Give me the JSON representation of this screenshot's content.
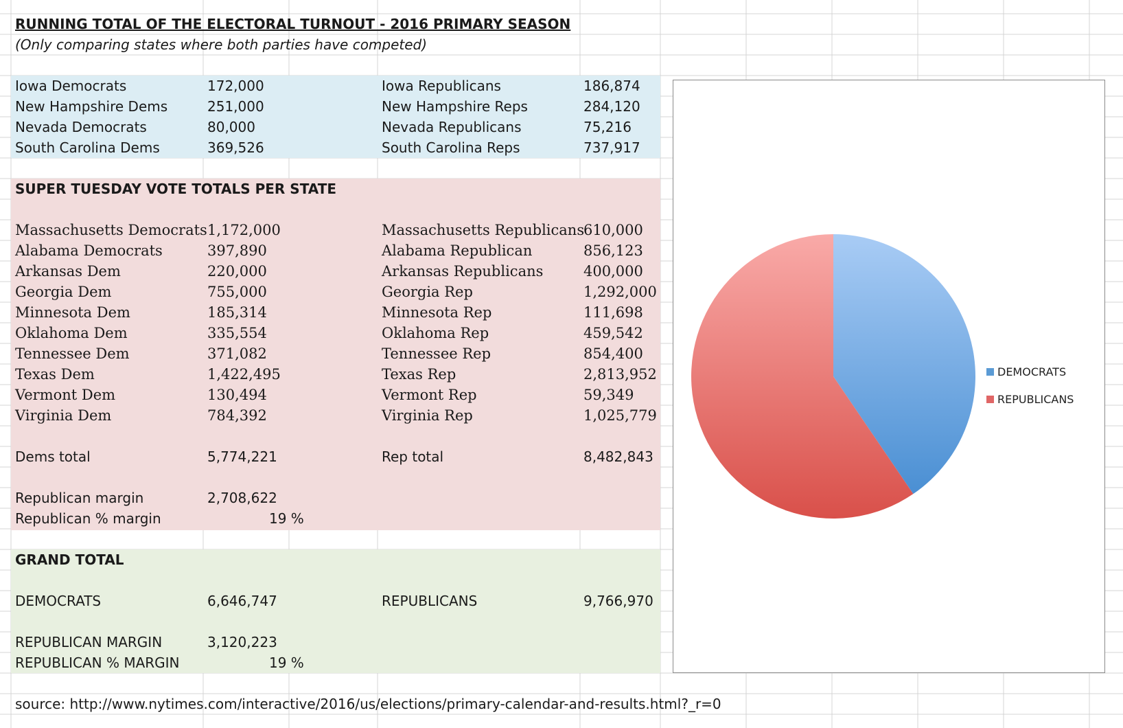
{
  "sheet": {
    "title": "RUNNING TOTAL OF THE ELECTORAL TURNOUT - 2016 PRIMARY SEASON",
    "subtitle": "(Only comparing states where both parties have competed)"
  },
  "early_states": [
    {
      "dem_label": "Iowa Democrats",
      "dem_value": "172,000",
      "rep_label": "Iowa Republicans",
      "rep_value": "186,874"
    },
    {
      "dem_label": "New Hampshire Dems",
      "dem_value": "251,000",
      "rep_label": "New Hampshire Reps",
      "rep_value": "284,120"
    },
    {
      "dem_label": "Nevada Democrats",
      "dem_value": "80,000",
      "rep_label": "Nevada Republicans",
      "rep_value": "75,216"
    },
    {
      "dem_label": "South Carolina Dems",
      "dem_value": "369,526",
      "rep_label": "South Carolina Reps",
      "rep_value": "737,917"
    }
  ],
  "super_tuesday": {
    "header": "SUPER TUESDAY VOTE TOTALS PER STATE",
    "rows": [
      {
        "dem_label": "Massachusetts Democrats",
        "dem_value": "1,172,000",
        "rep_label": "Massachusetts Republicans",
        "rep_value": "610,000"
      },
      {
        "dem_label": "Alabama Democrats",
        "dem_value": "397,890",
        "rep_label": "Alabama Republican",
        "rep_value": "856,123"
      },
      {
        "dem_label": "Arkansas Dem",
        "dem_value": "220,000",
        "rep_label": "Arkansas Republicans",
        "rep_value": "400,000"
      },
      {
        "dem_label": "Georgia Dem",
        "dem_value": "755,000",
        "rep_label": "Georgia Rep",
        "rep_value": "1,292,000"
      },
      {
        "dem_label": "Minnesota Dem",
        "dem_value": "185,314",
        "rep_label": "Minnesota Rep",
        "rep_value": "111,698"
      },
      {
        "dem_label": "Oklahoma Dem",
        "dem_value": "335,554",
        "rep_label": "Oklahoma Rep",
        "rep_value": "459,542"
      },
      {
        "dem_label": "Tennessee Dem",
        "dem_value": "371,082",
        "rep_label": "Tennessee Rep",
        "rep_value": "854,400"
      },
      {
        "dem_label": "Texas Dem",
        "dem_value": "1,422,495",
        "rep_label": "Texas Rep",
        "rep_value": "2,813,952"
      },
      {
        "dem_label": "Vermont Dem",
        "dem_value": "130,494",
        "rep_label": "Vermont Rep",
        "rep_value": "59,349"
      },
      {
        "dem_label": "Virginia Dem",
        "dem_value": "784,392",
        "rep_label": "Virginia Rep",
        "rep_value": "1,025,779"
      }
    ],
    "dems_total_label": "Dems total",
    "dems_total_value": "5,774,221",
    "rep_total_label": "Rep total",
    "rep_total_value": "8,482,843",
    "margin_label": "Republican margin",
    "margin_value": "2,708,622",
    "pct_margin_label": "Republican % margin",
    "pct_margin_value": "19 %"
  },
  "grand_total": {
    "header": "GRAND TOTAL",
    "dem_label": "DEMOCRATS",
    "dem_value": "6,646,747",
    "rep_label": "REPUBLICANS",
    "rep_value": "9,766,970",
    "margin_label": "REPUBLICAN MARGIN",
    "margin_value": "3,120,223",
    "pct_margin_label": "REPUBLICAN % MARGIN",
    "pct_margin_value": "19 %"
  },
  "source": "source: http://www.nytimes.com/interactive/2016/us/elections/primary-calendar-and-results.html?_r=0",
  "chart_data": {
    "type": "pie",
    "categories": [
      "DEMOCRATS",
      "REPUBLICANS"
    ],
    "values": [
      6646747,
      9766970
    ],
    "colors": [
      "#5b9bd5",
      "#e06666"
    ],
    "legend_position": "right"
  }
}
